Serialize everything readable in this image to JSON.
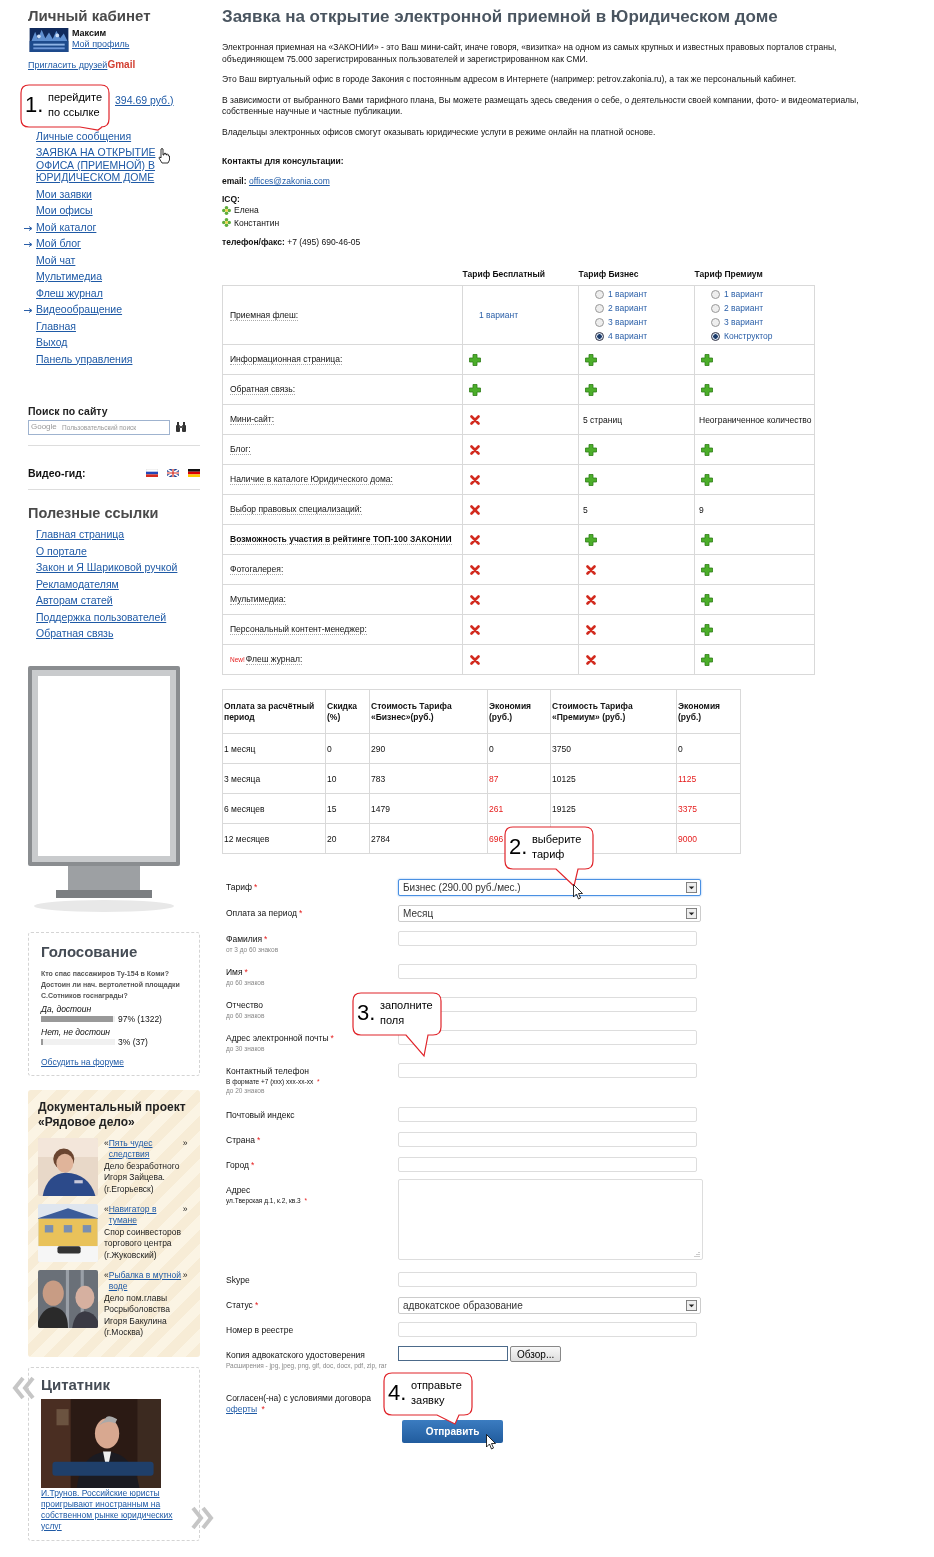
{
  "sidebar": {
    "cabinet": {
      "title": "Личный кабинет",
      "user_name": "Максим",
      "profile_link": "Мой профиль",
      "invite_link": "Пригласить друзей",
      "invite_service": "Gmail"
    },
    "menu": [
      {
        "label": "394.69 руб.)"
      },
      {
        "label": "Личные сообщения",
        "arrow": false
      },
      {
        "label": "ЗАЯВКА НА ОТКРЫТИЕ ОФИСА (ПРИЕМНОЙ) В ЮРИДИЧЕСКОМ ДОМЕ",
        "arrow": false
      },
      {
        "label": "Мои заявки",
        "arrow": false
      },
      {
        "label": "Мои офисы",
        "arrow": false
      },
      {
        "label": "Мой каталог",
        "arrow": true
      },
      {
        "label": "Мой блог",
        "arrow": true
      },
      {
        "label": "Мой чат",
        "arrow": false
      },
      {
        "label": "Мультимедиа",
        "arrow": false
      },
      {
        "label": "Флеш журнал",
        "arrow": false
      },
      {
        "label": "Видеообращение",
        "arrow": true
      },
      {
        "label": "Главная",
        "arrow": false
      },
      {
        "label": "Выход",
        "arrow": false
      },
      {
        "label": "Панель управления",
        "arrow": false
      }
    ],
    "search": {
      "title": "Поиск по сайту",
      "brand": "Google",
      "placeholder": "Пользовательский поиск"
    },
    "video_guide": {
      "label": "Видео-гид:"
    },
    "useful": {
      "title": "Полезные ссылки",
      "links": [
        "Главная страница",
        "О портале",
        "Закон и Я Шариковой ручкой",
        "Рекламодателям",
        "Авторам статей",
        "Поддержка пользователей",
        "Обратная связь"
      ]
    },
    "poll": {
      "title": "Голосование",
      "question": "Кто спас пассажиров Ту-154 в Коми? Достоин ли нач. вертолетной площадки С.Сотников госнаграды?",
      "options": [
        {
          "label": "Да, достоин",
          "level": 0.97,
          "result": "97% (1322)"
        },
        {
          "label": "Нет, не достоин",
          "level": 0.03,
          "result": "3% (37)"
        }
      ],
      "forum_link": "Обсудить на форуме"
    },
    "project": {
      "title": "Документальный проект «Рядовое дело»",
      "items": [
        {
          "open_quote": "«",
          "link": "Пять чудес следствия",
          "close_quote": "»",
          "text": "Дело безработного Игоря Зайцева. (г.Егорьевск)",
          "kind": "person"
        },
        {
          "open_quote": "«",
          "link": "Навигатор в тумане",
          "close_quote": "»",
          "text": "Спор соинвесторов торгового центра (г.Жуковский)",
          "kind": "building"
        },
        {
          "open_quote": "«",
          "link": "Рыбалка в мутной воде",
          "close_quote": "»",
          "text": "Дело пом.главы Росрыболовства Игоря Бакулина (г.Москва)",
          "kind": "people"
        }
      ]
    },
    "quotes": {
      "title": "Цитатник",
      "caption": "И.Трунов. Российские юристы проигрывают иностранным на собственном рынке юридических услуг"
    }
  },
  "main": {
    "title": "Заявка на открытие электронной приемной в Юридическом доме",
    "paragraphs": [
      "Электронная приемная на «ЗАКОНИИ» - это Ваш мини-сайт, иначе говоря, «визитка» на одном из самых крупных и известных правовых порталов страны, объединяющем 75.000 зарегистрированных пользователей и зарегистрированном как СМИ.",
      "Это Ваш виртуальный офис в городе Закония с постоянным адресом в Интернете (например: petrov.zakonia.ru), а так же персональный кабинет.",
      "В зависимости от выбранного Вами тарифного плана, Вы можете размещать здесь сведения о себе, о деятельности своей компании, фото- и видеоматериалы, собственные научные и частные публикации.",
      "Владельцы электронных офисов смогут оказывать юридические услуги в режиме онлайн на платной основе."
    ],
    "contacts": {
      "heading": "Контакты для консультации:",
      "email_label": "email:",
      "email": "offices@zakonia.com",
      "icq_label": "ICQ:",
      "icq": [
        "Елена",
        "Константин"
      ],
      "phone_label": "телефон/факс:",
      "phone": "+7 (495) 690-46-05"
    },
    "tariffs": {
      "columns": [
        "Тариф Бесплатный",
        "Тариф Бизнес",
        "Тариф Премиум"
      ],
      "flash": {
        "label": "Приемная флеш:",
        "free_option": "1 вариант",
        "business_options": [
          {
            "label": "1 вариант",
            "selected": false
          },
          {
            "label": "2 вариант",
            "selected": false
          },
          {
            "label": "3 вариант",
            "selected": false
          },
          {
            "label": "4 вариант",
            "selected": true
          }
        ],
        "premium_options": [
          {
            "label": "1 вариант",
            "selected": false
          },
          {
            "label": "2 вариант",
            "selected": false
          },
          {
            "label": "3 вариант",
            "selected": false
          },
          {
            "label": "Конструктор",
            "selected": true
          }
        ]
      },
      "rows": [
        {
          "label": "Информационная страница:",
          "bold": false,
          "cells": [
            {
              "kind": "yes"
            },
            {
              "kind": "yes"
            },
            {
              "kind": "yes"
            }
          ]
        },
        {
          "label": "Обратная связь:",
          "bold": false,
          "cells": [
            {
              "kind": "yes"
            },
            {
              "kind": "yes"
            },
            {
              "kind": "yes"
            }
          ]
        },
        {
          "label": "Мини-сайт:",
          "bold": false,
          "cells": [
            {
              "kind": "no"
            },
            {
              "kind": "text",
              "text": "5 страниц"
            },
            {
              "kind": "text",
              "text": "Неограниченное количество"
            }
          ]
        },
        {
          "label": "Блог:",
          "bold": false,
          "cells": [
            {
              "kind": "no"
            },
            {
              "kind": "yes"
            },
            {
              "kind": "yes"
            }
          ]
        },
        {
          "label": "Наличие в каталоге Юридического дома:",
          "bold": false,
          "cells": [
            {
              "kind": "no"
            },
            {
              "kind": "yes"
            },
            {
              "kind": "yes"
            }
          ]
        },
        {
          "label": "Выбор правовых специализаций:",
          "bold": false,
          "cells": [
            {
              "kind": "no"
            },
            {
              "kind": "text",
              "text": "5"
            },
            {
              "kind": "text",
              "text": "9"
            }
          ]
        },
        {
          "label": "Возможность участия в рейтинге ТОП-100 ЗАКОНИИ",
          "bold": true,
          "cells": [
            {
              "kind": "no"
            },
            {
              "kind": "yes"
            },
            {
              "kind": "yes"
            }
          ]
        },
        {
          "label": "Фотогалерея:",
          "bold": false,
          "cells": [
            {
              "kind": "no"
            },
            {
              "kind": "no"
            },
            {
              "kind": "yes"
            }
          ]
        },
        {
          "label": "Мультимедиа:",
          "bold": false,
          "cells": [
            {
              "kind": "no"
            },
            {
              "kind": "no"
            },
            {
              "kind": "yes"
            }
          ]
        },
        {
          "label": "Персональный контент-менеджер:",
          "bold": false,
          "cells": [
            {
              "kind": "no"
            },
            {
              "kind": "no"
            },
            {
              "kind": "yes"
            }
          ]
        },
        {
          "label": "Флеш журнал:",
          "bold": false,
          "badge": "New!",
          "cells": [
            {
              "kind": "no"
            },
            {
              "kind": "no"
            },
            {
              "kind": "yes"
            }
          ]
        }
      ]
    },
    "prices": {
      "columns": [
        "Оплата за расчётный период",
        "Скидка (%)",
        "Стоимость Тарифа «Бизнес»(руб.)",
        "Экономия (руб.)",
        "Стоимость Тарифа «Премиум» (руб.)",
        "Экономия (руб.)"
      ],
      "rows": [
        {
          "cells": [
            "1 месяц",
            "0",
            "290",
            "0",
            "3750",
            "0"
          ],
          "savings_highlighted": false
        },
        {
          "cells": [
            "3 месяца",
            "10",
            "783",
            "87",
            "10125",
            "1125"
          ],
          "savings_highlighted": true
        },
        {
          "cells": [
            "6 месяцев",
            "15",
            "1479",
            "261",
            "19125",
            "3375"
          ],
          "savings_highlighted": true
        },
        {
          "cells": [
            "12 месяцев",
            "20",
            "2784",
            "696",
            "",
            "9000"
          ],
          "savings_highlighted": true
        }
      ]
    },
    "form": {
      "fields": [
        {
          "kind": "select",
          "label": "Тариф",
          "required_mark": "*",
          "value": "Бизнес (290.00 руб./мес.)",
          "focused": true
        },
        {
          "kind": "select",
          "label": "Оплата за период",
          "required_mark": "*",
          "value": "Месяц",
          "focused": false
        },
        {
          "kind": "text",
          "label": "Фамилия",
          "required_mark": "*",
          "hint": "от 3 до 60 знаков"
        },
        {
          "kind": "text",
          "label": "Имя",
          "required_mark": "*",
          "hint": "до 60 знаков"
        },
        {
          "kind": "text",
          "label": "Отчество",
          "hint": "до 60 знаков"
        },
        {
          "kind": "text",
          "label": "Адрес электронной почты",
          "required_mark": "*",
          "hint": "до 30 знаков"
        },
        {
          "kind": "text",
          "label": "Контактный телефон",
          "required_mark": "*",
          "format": "В формате +7 (xxx) xxx-xx-xx",
          "hint": "до 20 знаков"
        },
        {
          "kind": "text",
          "label": "Почтовый индекс"
        },
        {
          "kind": "text",
          "label": "Страна",
          "required_mark": "*"
        },
        {
          "kind": "text",
          "label": "Город",
          "required_mark": "*"
        },
        {
          "kind": "textarea",
          "label": "Адрес",
          "required_mark": "*",
          "format": "ул.Тверская д.1, к.2, кв.3"
        },
        {
          "kind": "text",
          "label": "Skype"
        },
        {
          "kind": "select",
          "label": "Статус",
          "required_mark": "*",
          "value": "адвокатское образование",
          "focused": false
        },
        {
          "kind": "text",
          "label": "Номер в реестре"
        },
        {
          "kind": "file",
          "label": "Копия адвокатского удостоверения",
          "hint": "Расширения - jpg, jpeg, png, gif, doc, docx, pdf, zip, rar",
          "button": "Обзор..."
        },
        {
          "kind": "consent",
          "label": "Согласен(-на) с условиями договора",
          "link": "оферты",
          "required_mark": "*"
        }
      ],
      "submit": "Отправить"
    }
  },
  "callouts": [
    {
      "number": "1.",
      "text": "перейдите по ссылке"
    },
    {
      "number": "2.",
      "text": "выберите тариф"
    },
    {
      "number": "3.",
      "text": "заполните поля"
    },
    {
      "number": "4.",
      "text": "отправьте заявку"
    }
  ]
}
